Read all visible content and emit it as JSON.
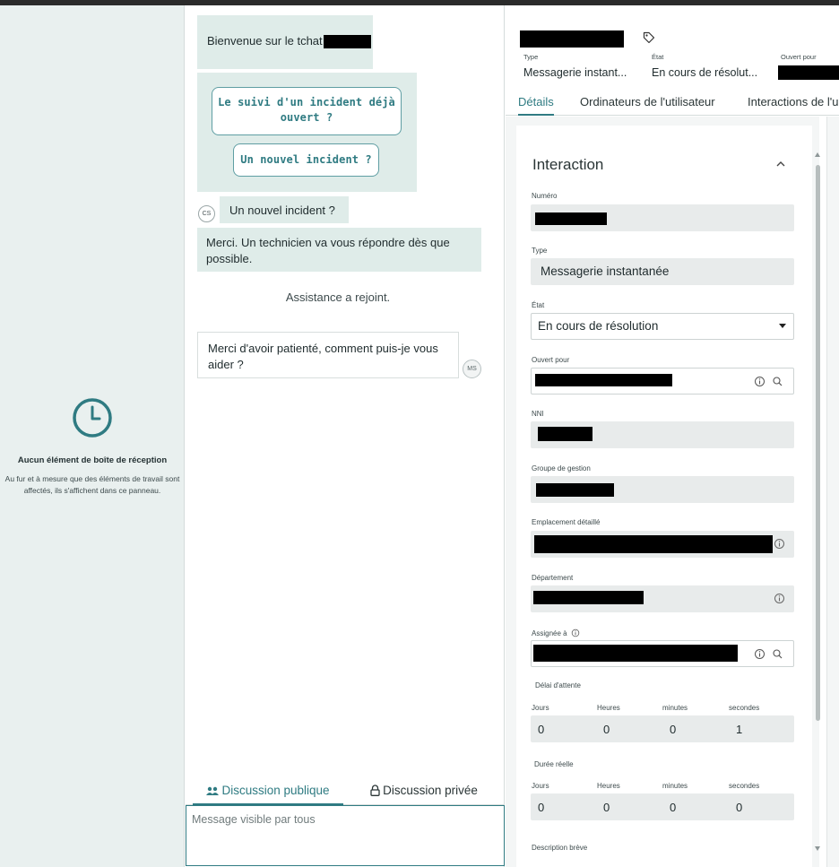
{
  "inbox": {
    "empty_title": "Aucun élément de boîte de réception",
    "empty_description": "Au fur et à mesure que des éléments de travail sont affectés, ils s'affichent dans ce panneau."
  },
  "chat": {
    "welcome": "Bienvenue sur le tchat",
    "option_followup": "Le suivi d'un incident déjà ouvert ?",
    "option_new": "Un nouvel incident ?",
    "user_avatar": "CS",
    "user_reply": "Un nouvel incident ?",
    "tech_message": "Merci. Un technicien va vous répondre dès que possible.",
    "system_message": "Assistance a rejoint.",
    "agent_message": "Merci d'avoir patienté, comment puis-je vous aider ?",
    "agent_avatar": "MS",
    "tab_public": "Discussion publique",
    "tab_private": "Discussion privée",
    "input_placeholder": "Message visible par tous"
  },
  "record": {
    "header": {
      "type_label": "Type",
      "type_value": "Messagerie instant...",
      "state_label": "État",
      "state_value": "En cours de résolut...",
      "opened_for_label": "Ouvert pour"
    },
    "tabs": [
      "Détails",
      "Ordinateurs de l'utilisateur",
      "Interactions de l'u"
    ],
    "section_title": "Interaction",
    "fields": {
      "numero_label": "Numéro",
      "type_label": "Type",
      "type_value": "Messagerie instantanée",
      "etat_label": "État",
      "etat_value": "En cours de résolution",
      "ouvert_pour_label": "Ouvert pour",
      "nni_label": "NNI",
      "groupe_label": "Groupe de gestion",
      "emplacement_label": "Emplacement détaillé",
      "departement_label": "Département",
      "assignee_label": "Assignée à"
    },
    "attente": {
      "label": "Délai d'attente",
      "units": [
        "Jours",
        "Heures",
        "minutes",
        "secondes"
      ],
      "values": [
        "0",
        "0",
        "0",
        "1"
      ]
    },
    "duree": {
      "label": "Durée réelle",
      "units": [
        "Jours",
        "Heures",
        "minutes",
        "secondes"
      ],
      "values": [
        "0",
        "0",
        "0",
        "0"
      ]
    },
    "description_label": "Description brève"
  },
  "colors": {
    "accent": "#2f7b82",
    "chat_bubble": "#dfece9",
    "left_panel": "#e9f0ef",
    "field_bg": "#e8ebeb"
  }
}
